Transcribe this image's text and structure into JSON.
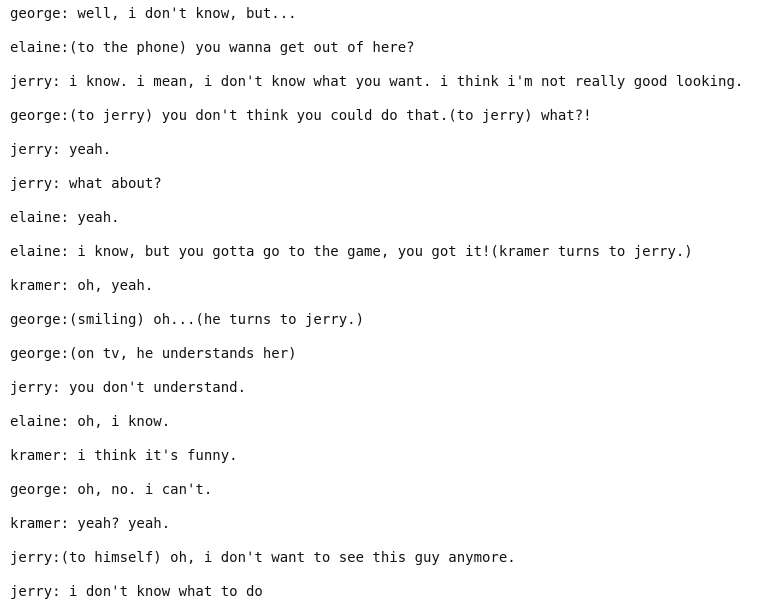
{
  "transcript": {
    "lines": [
      "george: well, i don't know, but...",
      "elaine:(to the phone) you wanna get out of here?",
      "jerry: i know. i mean, i don't know what you want. i think i'm not really good looking.",
      "george:(to jerry) you don't think you could do that.(to jerry) what?!",
      "jerry: yeah.",
      "jerry: what about?",
      "elaine: yeah.",
      "elaine: i know, but you gotta go to the game, you got it!(kramer turns to jerry.)",
      "kramer: oh, yeah.",
      "george:(smiling) oh...(he turns to jerry.)",
      "george:(on tv, he understands her)",
      "jerry: you don't understand.",
      "elaine: oh, i know.",
      "kramer: i think it's funny.",
      "george: oh, no. i can't.",
      "kramer: yeah? yeah.",
      "jerry:(to himself) oh, i don't want to see this guy anymore.",
      "jerry: i don't know what to do"
    ]
  }
}
